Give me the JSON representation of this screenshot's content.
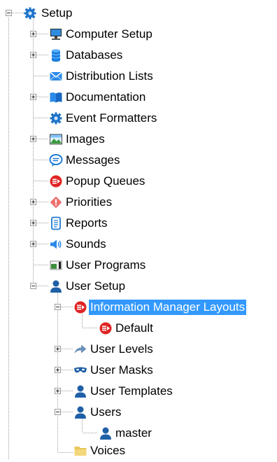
{
  "tree": {
    "root": {
      "label": "Setup",
      "icon": "gear-icon"
    },
    "items": [
      {
        "label": "Computer Setup",
        "icon": "computer-icon"
      },
      {
        "label": "Databases",
        "icon": "database-icon"
      },
      {
        "label": "Distribution Lists",
        "icon": "envelope-icon"
      },
      {
        "label": "Documentation",
        "icon": "book-icon"
      },
      {
        "label": "Event Formatters",
        "icon": "gear-icon"
      },
      {
        "label": "Images",
        "icon": "image-icon"
      },
      {
        "label": "Messages",
        "icon": "speech-bubble-icon"
      },
      {
        "label": "Popup Queues",
        "icon": "popup-queue-icon"
      },
      {
        "label": "Priorities",
        "icon": "priority-diamond-icon"
      },
      {
        "label": "Reports",
        "icon": "report-icon"
      },
      {
        "label": "Sounds",
        "icon": "speaker-icon"
      },
      {
        "label": "User Programs",
        "icon": "program-icon"
      },
      {
        "label": "User Setup",
        "icon": "user-icon"
      }
    ],
    "user_setup_children": [
      {
        "label": "Information Manager Layouts",
        "icon": "popup-queue-icon",
        "selected": true
      },
      {
        "label": "User Levels",
        "icon": "arrow-icon"
      },
      {
        "label": "User Masks",
        "icon": "mask-icon"
      },
      {
        "label": "User Templates",
        "icon": "user-icon"
      },
      {
        "label": "Users",
        "icon": "user-icon"
      },
      {
        "label": "Voices",
        "icon": "folder-icon"
      }
    ],
    "layouts_children": [
      {
        "label": "Default",
        "icon": "popup-queue-icon"
      }
    ],
    "users_children": [
      {
        "label": "master",
        "icon": "user-icon"
      }
    ]
  },
  "colors": {
    "selection": "#3399ff",
    "tree_line": "#a0a0a0",
    "gear": "#1e73c8",
    "user": "#1f5fa6",
    "popup_red": "#e02424"
  }
}
